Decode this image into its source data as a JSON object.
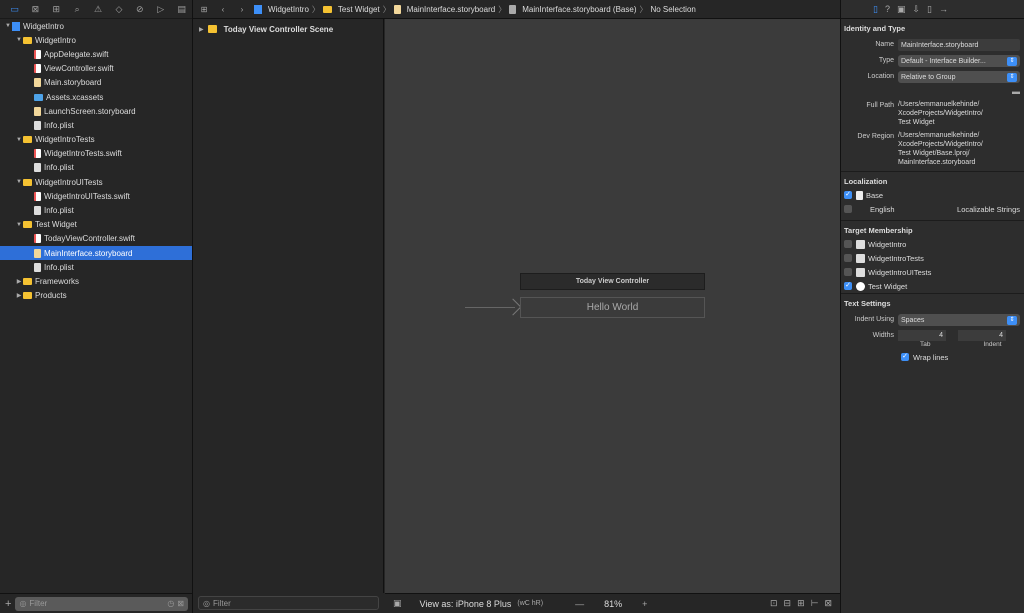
{
  "navigator": {
    "tree": [
      {
        "label": "WidgetIntro",
        "depth": 0,
        "icon": "project",
        "tri": "▼"
      },
      {
        "label": "WidgetIntro",
        "depth": 1,
        "icon": "folder",
        "tri": "▼"
      },
      {
        "label": "AppDelegate.swift",
        "depth": 2,
        "icon": "swift"
      },
      {
        "label": "ViewController.swift",
        "depth": 2,
        "icon": "swift"
      },
      {
        "label": "Main.storyboard",
        "depth": 2,
        "icon": "storyboard"
      },
      {
        "label": "Assets.xcassets",
        "depth": 2,
        "icon": "assets"
      },
      {
        "label": "LaunchScreen.storyboard",
        "depth": 2,
        "icon": "storyboard"
      },
      {
        "label": "Info.plist",
        "depth": 2,
        "icon": "plist"
      },
      {
        "label": "WidgetIntroTests",
        "depth": 1,
        "icon": "folder",
        "tri": "▼"
      },
      {
        "label": "WidgetIntroTests.swift",
        "depth": 2,
        "icon": "swift"
      },
      {
        "label": "Info.plist",
        "depth": 2,
        "icon": "plist"
      },
      {
        "label": "WidgetIntroUITests",
        "depth": 1,
        "icon": "folder",
        "tri": "▼"
      },
      {
        "label": "WidgetIntroUITests.swift",
        "depth": 2,
        "icon": "swift"
      },
      {
        "label": "Info.plist",
        "depth": 2,
        "icon": "plist"
      },
      {
        "label": "Test Widget",
        "depth": 1,
        "icon": "folder",
        "tri": "▼"
      },
      {
        "label": "TodayViewController.swift",
        "depth": 2,
        "icon": "swift"
      },
      {
        "label": "MainInterface.storyboard",
        "depth": 2,
        "icon": "storyboard",
        "selected": true
      },
      {
        "label": "Info.plist",
        "depth": 2,
        "icon": "plist"
      },
      {
        "label": "Frameworks",
        "depth": 1,
        "icon": "folder",
        "tri": "▶"
      },
      {
        "label": "Products",
        "depth": 1,
        "icon": "folder",
        "tri": "▶"
      }
    ],
    "filter_placeholder": "Filter"
  },
  "jumpbar": {
    "crumbs": [
      "WidgetIntro",
      "Test Widget",
      "MainInterface.storyboard",
      "MainInterface.storyboard (Base)",
      "No Selection"
    ]
  },
  "outline": {
    "scene": "Today View Controller Scene",
    "filter_placeholder": "Filter"
  },
  "canvas": {
    "vc_title": "Today View Controller",
    "label": "Hello World",
    "view_as": "View as: iPhone 8 Plus",
    "view_as_shortcut": "(wC hR)",
    "zoom_minus": "—",
    "zoom": "81%",
    "zoom_plus": "+"
  },
  "inspector": {
    "identity_title": "Identity and Type",
    "name_label": "Name",
    "name_value": "MainInterface.storyboard",
    "type_label": "Type",
    "type_value": "Default - Interface Builder...",
    "location_label": "Location",
    "location_value": "Relative to Group",
    "fullpath_label": "Full Path",
    "fullpath_value": "/Users/emmanuelkehinde/\nXcodeProjects/WidgetIntro/\nTest Widget",
    "devregion_label": "Dev Region",
    "devregion_value": "/Users/emmanuelkehinde/\nXcodeProjects/WidgetIntro/\nTest Widget/Base.lproj/\nMainInterface.storyboard",
    "localization_title": "Localization",
    "loc_base": "Base",
    "loc_english": "English",
    "loc_english_value": "Localizable Strings",
    "membership_title": "Target Membership",
    "targets": [
      {
        "label": "WidgetIntro",
        "checked": false
      },
      {
        "label": "WidgetIntroTests",
        "checked": false
      },
      {
        "label": "WidgetIntroUITests",
        "checked": false
      },
      {
        "label": "Test Widget",
        "checked": true
      }
    ],
    "text_title": "Text Settings",
    "indent_label": "Indent Using",
    "indent_value": "Spaces",
    "widths_label": "Widths",
    "tab_value": "4",
    "indent_num": "4",
    "tab_caption": "Tab",
    "indent_caption": "Indent",
    "wrap_label": "Wrap lines"
  },
  "colors": {
    "accent": "#3d8ff7",
    "selection": "#2e6fd8",
    "folder": "#f5c232"
  }
}
